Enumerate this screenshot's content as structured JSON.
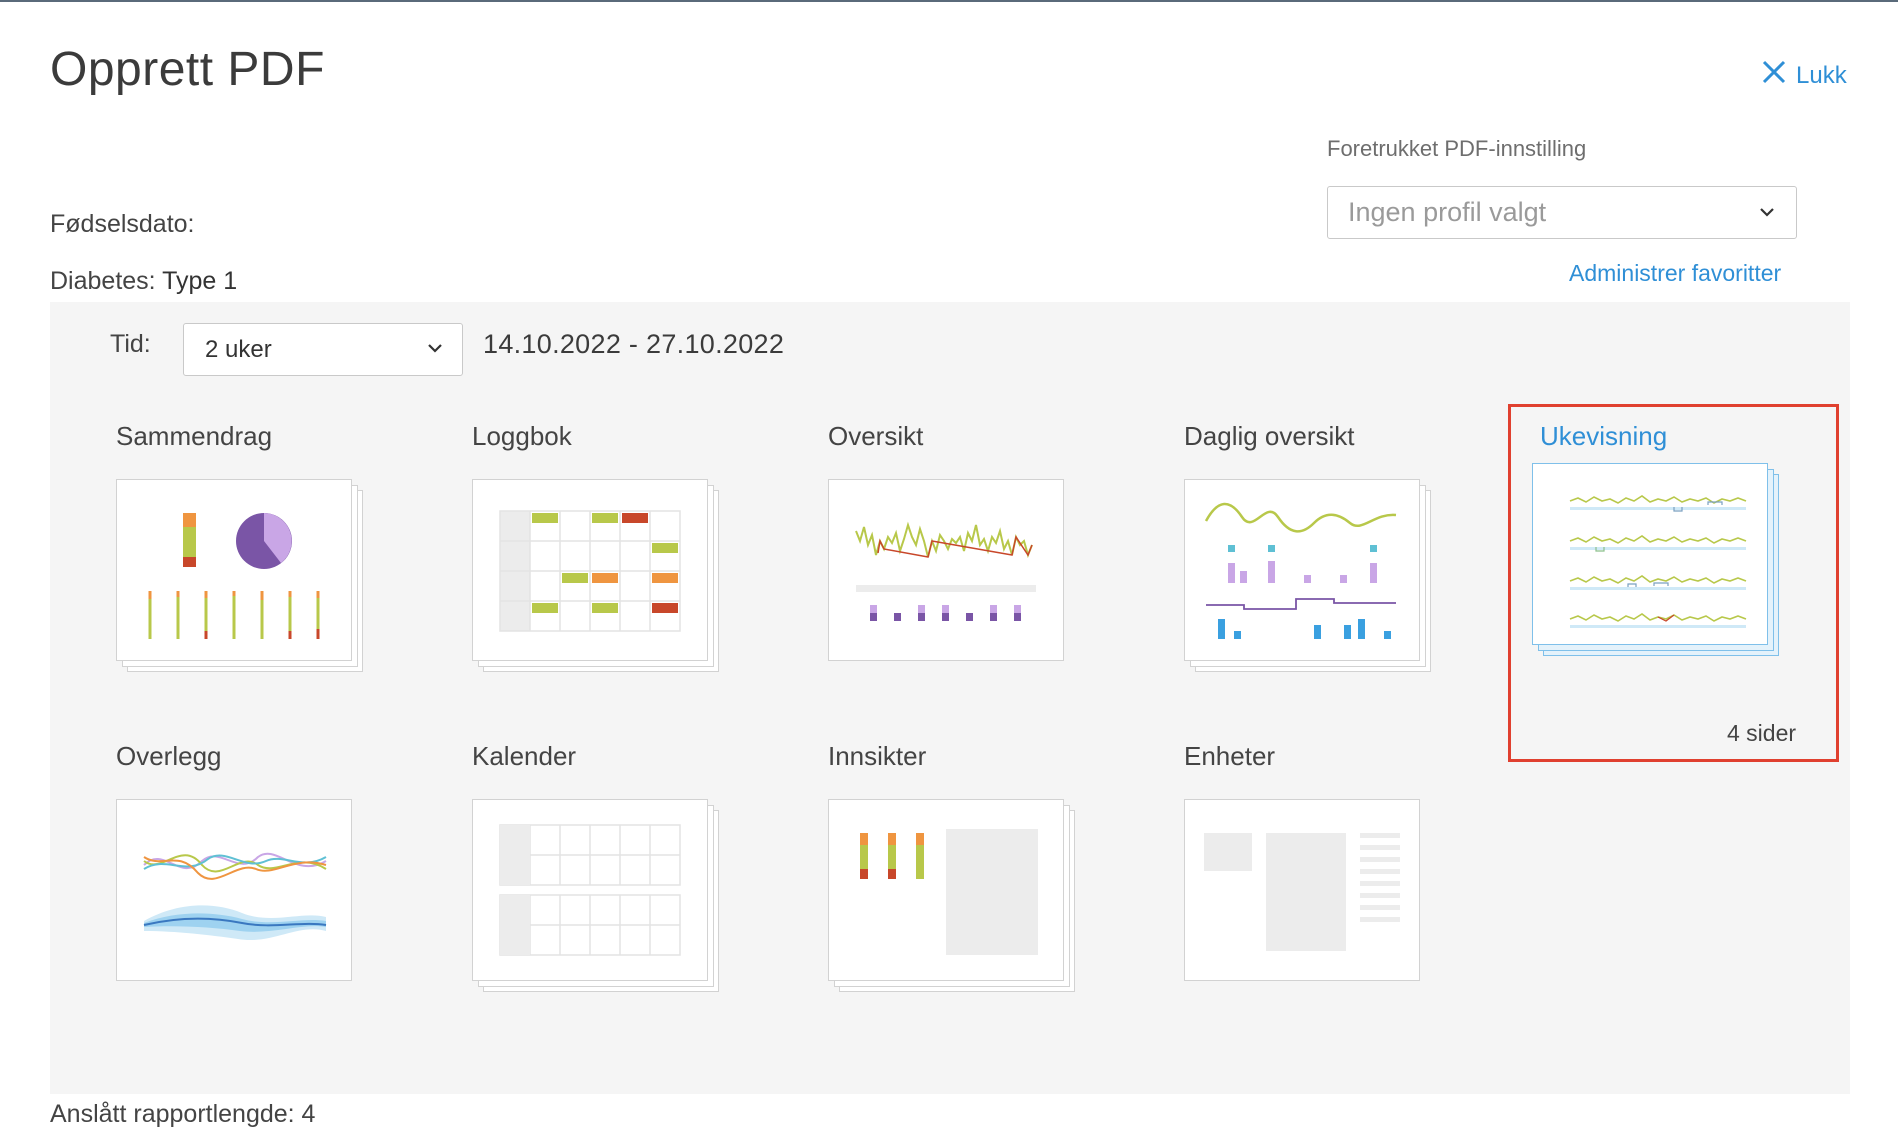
{
  "dialog": {
    "title": "Opprett PDF",
    "close_label": "Lukk",
    "preferred_label": "Foretrukket PDF-innstilling",
    "profile_value": "Ingen profil valgt",
    "admin_link": "Administrer favoritter",
    "dob_label": "Fødselsdato:",
    "diabetes_label": "Diabetes:",
    "diabetes_value": "Type 1",
    "time_label": "Tid:",
    "time_value": "2 uker",
    "date_range": "14.10.2022 - 27.10.2022",
    "bottom_text": "Anslått rapportlengde: 4"
  },
  "reports": [
    {
      "label": "Sammendrag"
    },
    {
      "label": "Loggbok"
    },
    {
      "label": "Oversikt"
    },
    {
      "label": "Daglig oversikt"
    },
    {
      "label": "Ukevisning",
      "selected": true,
      "pages": "4 sider"
    },
    {
      "label": "Overlegg"
    },
    {
      "label": "Kalender"
    },
    {
      "label": "Innsikter"
    },
    {
      "label": "Enheter"
    }
  ],
  "colors": {
    "accent": "#2f8fd6",
    "selection_border": "#e0402f",
    "green": "#b8c84a",
    "orange": "#ef9540",
    "red": "#c8472a",
    "purple": "#7a55a6",
    "light_purple": "#c9a6e6",
    "blue": "#3aa0e0"
  }
}
